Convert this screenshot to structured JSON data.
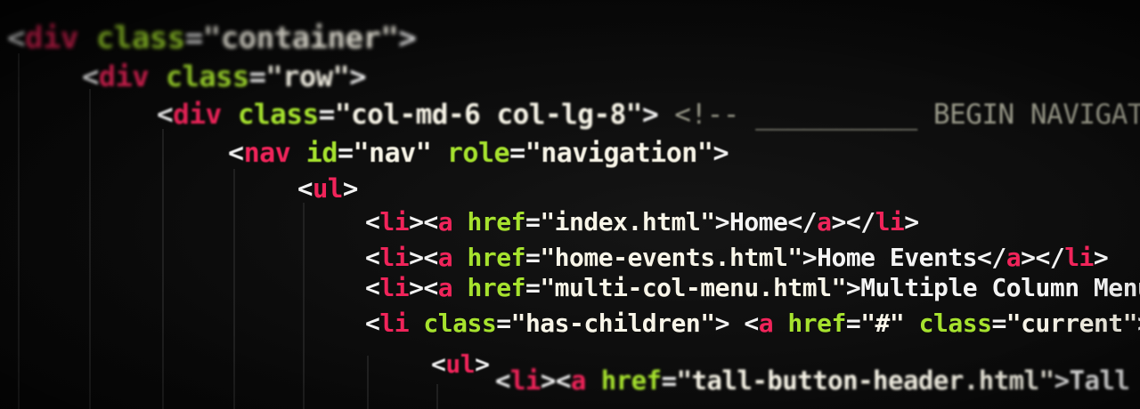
{
  "colors": {
    "background": "#0b0b0b",
    "punctuation": "#f2f2f2",
    "tag": "#f0245a",
    "attribute": "#a6e22e",
    "string": "#f8f5e8",
    "text": "#f4f4f4",
    "comment": "#9a9a8a"
  },
  "code_lines": [
    [
      [
        "punct",
        "<"
      ],
      [
        "tag",
        "div"
      ],
      [
        "attr",
        " class"
      ],
      [
        "punct",
        "="
      ],
      [
        "str",
        "\"container\""
      ],
      [
        "punct",
        ">"
      ]
    ],
    [
      [
        "punct",
        "<"
      ],
      [
        "tag",
        "div"
      ],
      [
        "attr",
        " class"
      ],
      [
        "punct",
        "="
      ],
      [
        "str",
        "\"row\""
      ],
      [
        "punct",
        ">"
      ]
    ],
    [
      [
        "punct",
        "<"
      ],
      [
        "tag",
        "div"
      ],
      [
        "attr",
        " class"
      ],
      [
        "punct",
        "="
      ],
      [
        "str",
        "\"col-md-6 col-lg-8\""
      ],
      [
        "punct",
        ">"
      ],
      [
        "comment",
        " <!-- __________ BEGIN NAVIGATION _"
      ]
    ],
    [
      [
        "punct",
        "<"
      ],
      [
        "tag",
        "nav"
      ],
      [
        "attr",
        " id"
      ],
      [
        "punct",
        "="
      ],
      [
        "str",
        "\"nav\""
      ],
      [
        "attr",
        " role"
      ],
      [
        "punct",
        "="
      ],
      [
        "str",
        "\"navigation\""
      ],
      [
        "punct",
        ">"
      ]
    ],
    [
      [
        "punct",
        "<"
      ],
      [
        "tag",
        "ul"
      ],
      [
        "punct",
        ">"
      ]
    ],
    [
      [
        "punct",
        "<"
      ],
      [
        "tag",
        "li"
      ],
      [
        "punct",
        "><"
      ],
      [
        "tag",
        "a"
      ],
      [
        "attr",
        " href"
      ],
      [
        "punct",
        "="
      ],
      [
        "str",
        "\"index.html\""
      ],
      [
        "punct",
        ">"
      ],
      [
        "text",
        "Home"
      ],
      [
        "punct",
        "</"
      ],
      [
        "tag",
        "a"
      ],
      [
        "punct",
        "></"
      ],
      [
        "tag",
        "li"
      ],
      [
        "punct",
        ">"
      ]
    ],
    [
      [
        "punct",
        "<"
      ],
      [
        "tag",
        "li"
      ],
      [
        "punct",
        "><"
      ],
      [
        "tag",
        "a"
      ],
      [
        "attr",
        " href"
      ],
      [
        "punct",
        "="
      ],
      [
        "str",
        "\"home-events.html\""
      ],
      [
        "punct",
        ">"
      ],
      [
        "text",
        "Home Events"
      ],
      [
        "punct",
        "</"
      ],
      [
        "tag",
        "a"
      ],
      [
        "punct",
        "></"
      ],
      [
        "tag",
        "li"
      ],
      [
        "punct",
        ">"
      ]
    ],
    [
      [
        "punct",
        "<"
      ],
      [
        "tag",
        "li"
      ],
      [
        "punct",
        "><"
      ],
      [
        "tag",
        "a"
      ],
      [
        "attr",
        " href"
      ],
      [
        "punct",
        "="
      ],
      [
        "str",
        "\"multi-col-menu.html\""
      ],
      [
        "punct",
        ">"
      ],
      [
        "text",
        "Multiple Column Menu"
      ]
    ],
    [
      [
        "punct",
        "<"
      ],
      [
        "tag",
        "li"
      ],
      [
        "attr",
        " class"
      ],
      [
        "punct",
        "="
      ],
      [
        "str",
        "\"has-children\""
      ],
      [
        "punct",
        "> <"
      ],
      [
        "tag",
        "a"
      ],
      [
        "attr",
        " href"
      ],
      [
        "punct",
        "="
      ],
      [
        "str",
        "\"#\""
      ],
      [
        "attr",
        " class"
      ],
      [
        "punct",
        "="
      ],
      [
        "str",
        "\"current\""
      ],
      [
        "punct",
        ">"
      ]
    ],
    [
      [
        "punct",
        "<"
      ],
      [
        "tag",
        "ul"
      ],
      [
        "punct",
        ">"
      ]
    ],
    [
      [
        "punct",
        "<"
      ],
      [
        "tag",
        "li"
      ],
      [
        "punct",
        "><"
      ],
      [
        "tag",
        "a"
      ],
      [
        "attr",
        " href"
      ],
      [
        "punct",
        "="
      ],
      [
        "str",
        "\"tall-button-header.html\""
      ],
      [
        "punct",
        ">"
      ],
      [
        "text",
        "Tall Button"
      ]
    ]
  ]
}
